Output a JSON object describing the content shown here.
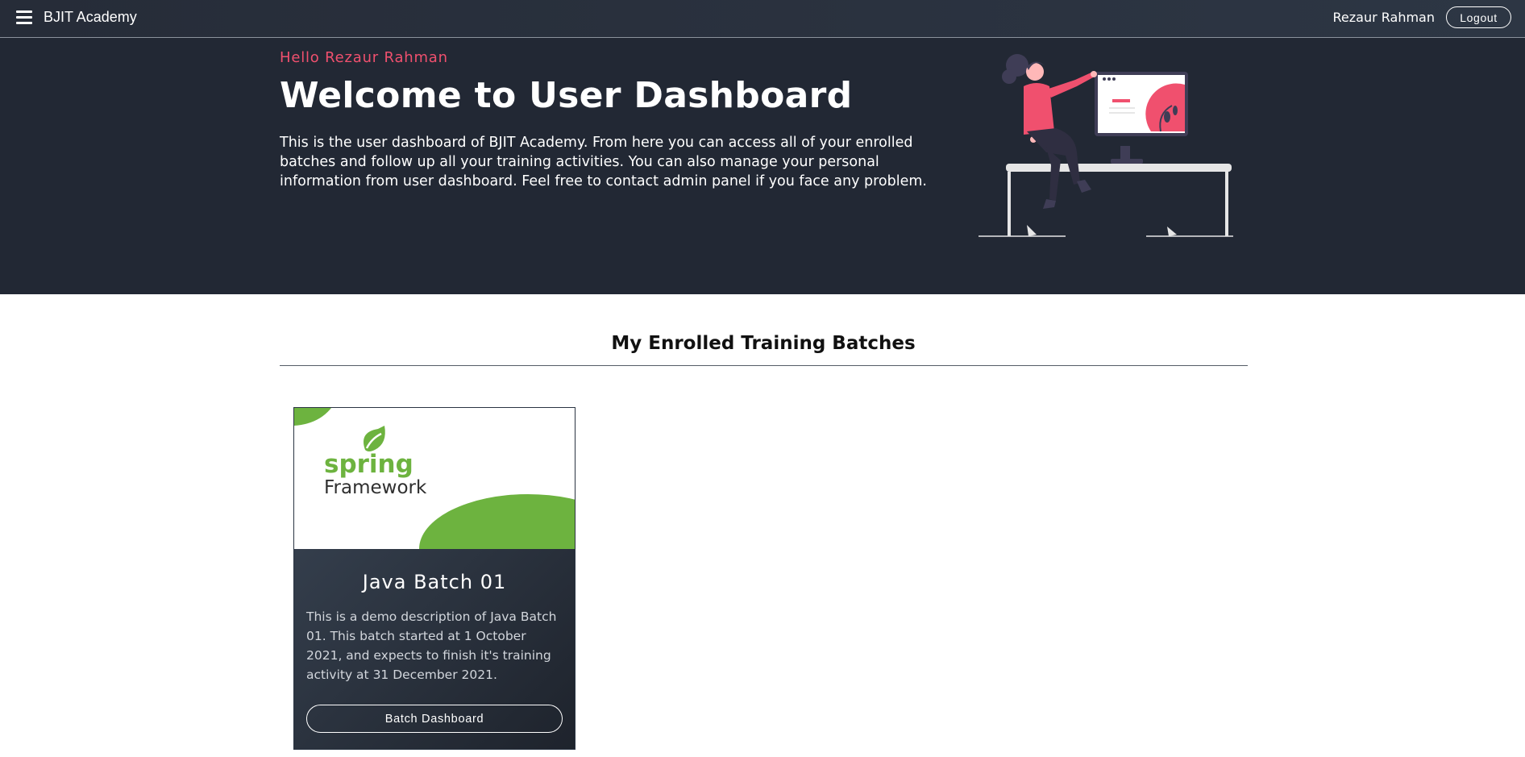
{
  "navbar": {
    "menu_icon": "hamburger-menu-icon",
    "brand": "BJIT Academy",
    "user_name": "Rezaur Rahman",
    "logout_label": "Logout"
  },
  "hero": {
    "greeting": "Hello Rezaur Rahman",
    "title": "Welcome to User Dashboard",
    "description": "This is the user dashboard of BJIT Academy. From here you can access all of your enrolled batches and follow up all your training activities. You can also manage your personal information from user dashboard. Feel free to contact admin panel if you face any problem."
  },
  "section": {
    "title": "My Enrolled Training Batches"
  },
  "batches": [
    {
      "logo_word_1": "spring",
      "logo_word_2": "Framework",
      "title": "Java Batch 01",
      "description": "This is a demo description of Java Batch 01. This batch started at 1 October 2021, and expects to finish it's training activity at 31 December 2021.",
      "button_label": "Batch Dashboard"
    }
  ],
  "colors": {
    "accent": "#f0506e",
    "navbar_bg": "#262c38",
    "hero_bg": "#222834",
    "spring_green": "#6db33f"
  }
}
